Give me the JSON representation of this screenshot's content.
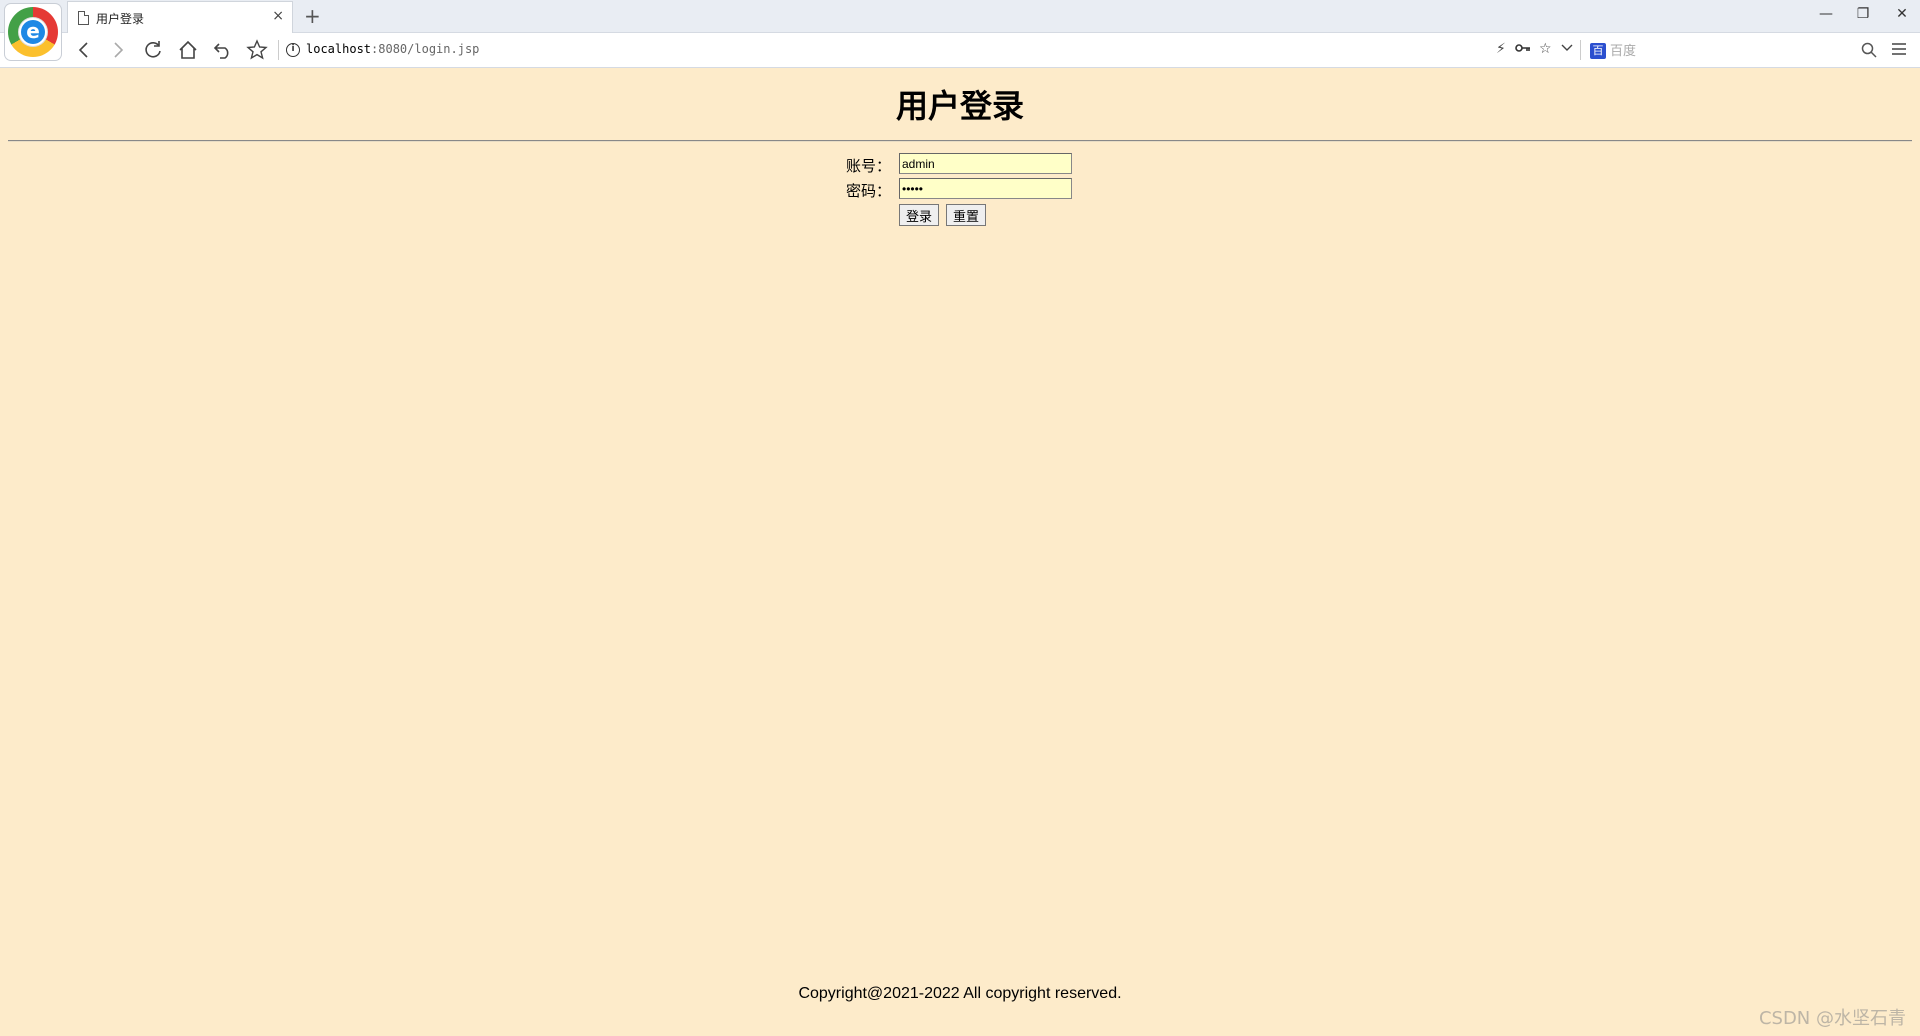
{
  "browser": {
    "tab_title": "用户登录",
    "tab_close": "×",
    "new_tab": "+",
    "url_host": "localhost",
    "url_rest": ":8080/login.jsp",
    "search_placeholder": "百度",
    "controls": {
      "minimize": "—",
      "restore": "❐",
      "close": "✕"
    },
    "icons": [
      "back-icon",
      "forward-icon",
      "reload-icon",
      "home-icon",
      "undo-icon",
      "star-icon",
      "info-icon",
      "lightning-icon",
      "key-icon",
      "bookmark-star-icon",
      "dropdown-icon",
      "baidu-icon",
      "search-icon",
      "menu-icon"
    ]
  },
  "page": {
    "title": "用户登录",
    "account_label": "账号：",
    "account_value": "admin",
    "password_label": "密码：",
    "password_value": "*****",
    "login_button": "登录",
    "reset_button": "重置",
    "footer": "Copyright@2021-2022 All copyright reserved.",
    "watermark": "CSDN @水坚石青"
  },
  "colors": {
    "page_background": "#fdebca",
    "input_background": "#ffffc8"
  }
}
